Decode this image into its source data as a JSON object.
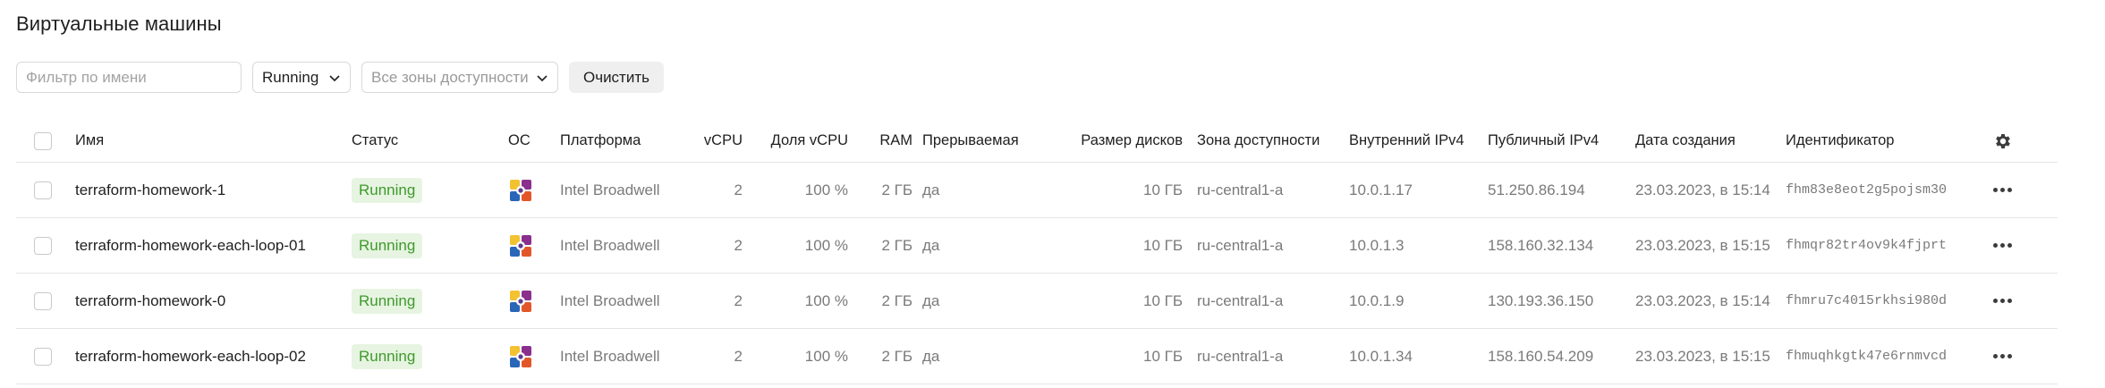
{
  "page": {
    "title": "Виртуальные машины"
  },
  "filters": {
    "name_placeholder": "Фильтр по имени",
    "status_value": "Running",
    "zones_placeholder": "Все зоны доступности",
    "clear_label": "Очистить"
  },
  "table": {
    "columns": {
      "name": "Имя",
      "status": "Статус",
      "os": "ОС",
      "platform": "Платформа",
      "vcpu": "vCPU",
      "vcpu_share": "Доля vCPU",
      "ram": "RAM",
      "preemptible": "Прерываемая",
      "disk_size": "Размер дисков",
      "zone": "Зона доступности",
      "internal_ip": "Внутренний IPv4",
      "public_ip": "Публичный IPv4",
      "created": "Дата создания",
      "id": "Идентификатор"
    },
    "rows": [
      {
        "name": "terraform-homework-1",
        "status": "Running",
        "platform": "Intel Broadwell",
        "vcpu": "2",
        "vcpu_share": "100 %",
        "ram": "2 ГБ",
        "preemptible": "да",
        "disk_size": "10 ГБ",
        "zone": "ru-central1-a",
        "internal_ip": "10.0.1.17",
        "public_ip": "51.250.86.194",
        "created": "23.03.2023, в 15:14",
        "id": "fhm83e8eot2g5pojsm30"
      },
      {
        "name": "terraform-homework-each-loop-01",
        "status": "Running",
        "platform": "Intel Broadwell",
        "vcpu": "2",
        "vcpu_share": "100 %",
        "ram": "2 ГБ",
        "preemptible": "да",
        "disk_size": "10 ГБ",
        "zone": "ru-central1-a",
        "internal_ip": "10.0.1.3",
        "public_ip": "158.160.32.134",
        "created": "23.03.2023, в 15:15",
        "id": "fhmqr82tr4ov9k4fjprt"
      },
      {
        "name": "terraform-homework-0",
        "status": "Running",
        "platform": "Intel Broadwell",
        "vcpu": "2",
        "vcpu_share": "100 %",
        "ram": "2 ГБ",
        "preemptible": "да",
        "disk_size": "10 ГБ",
        "zone": "ru-central1-a",
        "internal_ip": "10.0.1.9",
        "public_ip": "130.193.36.150",
        "created": "23.03.2023, в 15:14",
        "id": "fhmru7c4015rkhsi980d"
      },
      {
        "name": "terraform-homework-each-loop-02",
        "status": "Running",
        "platform": "Intel Broadwell",
        "vcpu": "2",
        "vcpu_share": "100 %",
        "ram": "2 ГБ",
        "preemptible": "да",
        "disk_size": "10 ГБ",
        "zone": "ru-central1-a",
        "internal_ip": "10.0.1.34",
        "public_ip": "158.160.54.209",
        "created": "23.03.2023, в 15:15",
        "id": "fhmuqhkgtk47e6rnmvcd"
      }
    ]
  },
  "icons": {
    "os": "linux-os-icon",
    "settings": "gear-icon",
    "row_menu": "more-actions-icon",
    "select_arrow": "chevron-down-icon"
  },
  "colors": {
    "status_running_bg": "#e6f4e1",
    "status_running_text": "#3f9a2c",
    "muted_text": "#7a7a7a",
    "row_border": "#e4e4e4"
  }
}
